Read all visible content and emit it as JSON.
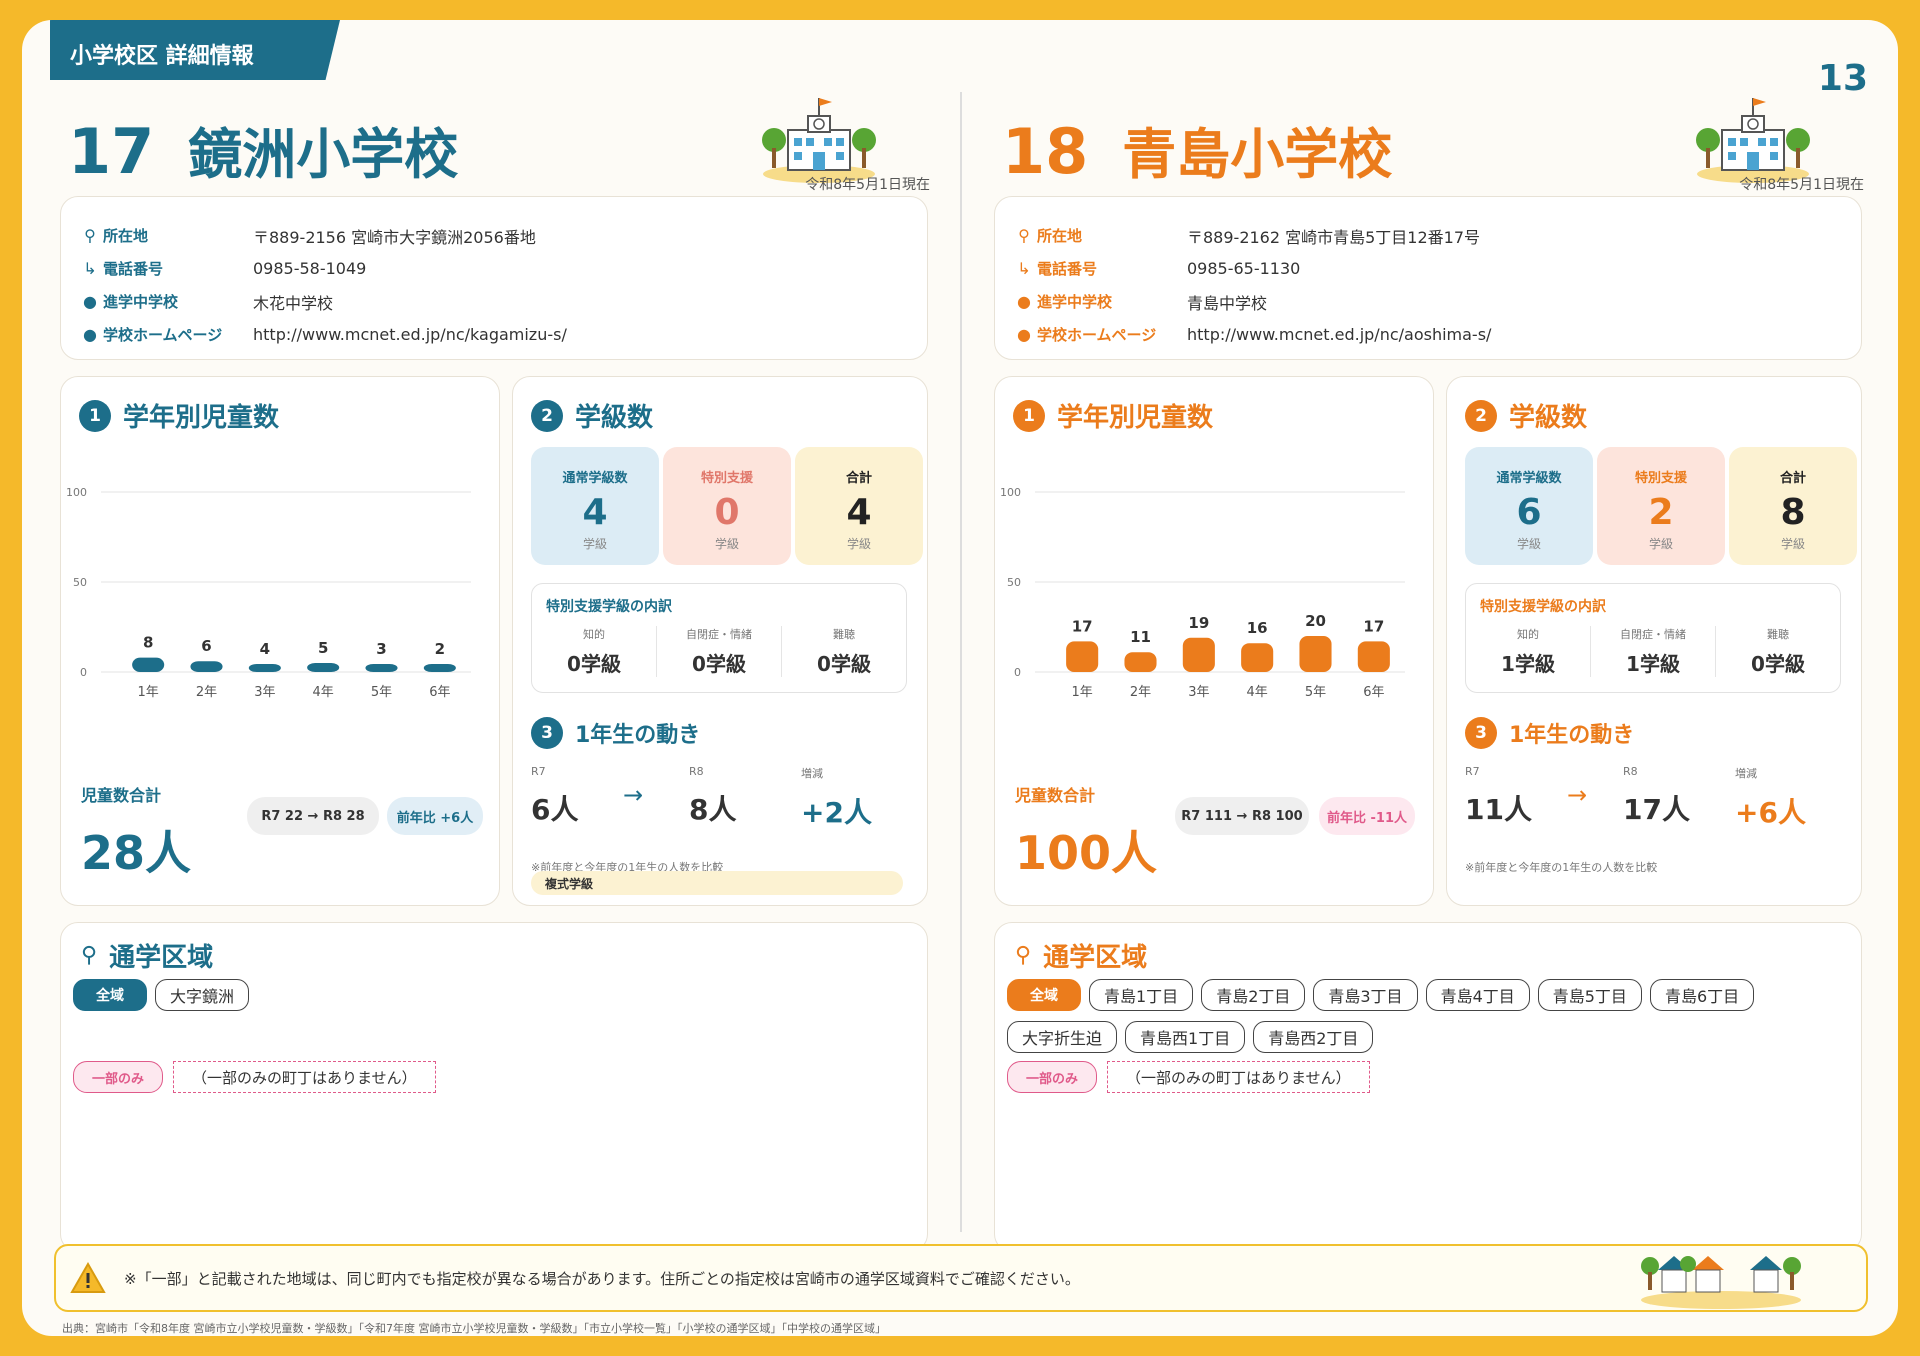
{
  "header": {
    "tab": "小学校区 詳細情報",
    "page_number": "13"
  },
  "schools": [
    {
      "number": "17",
      "name": "鏡洲小学校",
      "as_of": "令和8年5月1日現在",
      "info": [
        {
          "label": "所在地",
          "value": "〒889-2156 宮崎市大字鏡洲2056番地"
        },
        {
          "label": "電話番号",
          "value": "0985-58-1049"
        },
        {
          "label": "進学中学校",
          "value": "木花中学校"
        },
        {
          "label": "学校ホームページ",
          "value": "http://www.mcnet.ed.jp/nc/kagamizu-s/"
        }
      ],
      "grade_section": {
        "num": "1",
        "title": "学年別児童数",
        "chart_data": {
          "type": "bar",
          "categories": [
            "1年",
            "2年",
            "3年",
            "4年",
            "5年",
            "6年"
          ],
          "values": [
            8,
            6,
            4,
            5,
            3,
            2
          ],
          "ylim": [
            0,
            100
          ],
          "yticks": [
            "0",
            "50",
            "100"
          ],
          "grid": true
        },
        "total_label": "児童数合計",
        "total_value": "28人",
        "compare": "R7 22 → R8 28",
        "yoy": "前年比 +6人"
      },
      "class_section": {
        "num": "2",
        "title": "学級数",
        "boxes": [
          {
            "label": "通常学級数",
            "value": "4",
            "unit": "学級"
          },
          {
            "label": "特別支援",
            "value": "0",
            "unit": "学級"
          },
          {
            "label": "合計",
            "value": "4",
            "unit": "学級"
          }
        ],
        "breakdown_title": "特別支援学級の内訳",
        "breakdown": [
          {
            "label": "知的",
            "value": "0学級"
          },
          {
            "label": "自閉症・情緒",
            "value": "0学級"
          },
          {
            "label": "難聴",
            "value": "0学級"
          }
        ]
      },
      "move_section": {
        "num": "3",
        "title": "1年生の動き",
        "r7_label": "R7",
        "r7_value": "6人",
        "arrow": "→",
        "r8_label": "R8",
        "r8_value": "8人",
        "diff_label": "増減",
        "diff_value": "+2人",
        "note": "※前年度と今年度の1年生の人数を比較",
        "extra": "複式学級"
      },
      "area": {
        "title": "通学区域",
        "all_label": "全域",
        "all_items": [
          "大字鏡洲"
        ],
        "partial_label": "一部のみ",
        "partial_value": "（一部のみの町丁はありません）"
      }
    },
    {
      "number": "18",
      "name": "青島小学校",
      "as_of": "令和8年5月1日現在",
      "info": [
        {
          "label": "所在地",
          "value": "〒889-2162 宮崎市青島5丁目12番17号"
        },
        {
          "label": "電話番号",
          "value": "0985-65-1130"
        },
        {
          "label": "進学中学校",
          "value": "青島中学校"
        },
        {
          "label": "学校ホームページ",
          "value": "http://www.mcnet.ed.jp/nc/aoshima-s/"
        }
      ],
      "grade_section": {
        "num": "1",
        "title": "学年別児童数",
        "chart_data": {
          "type": "bar",
          "categories": [
            "1年",
            "2年",
            "3年",
            "4年",
            "5年",
            "6年"
          ],
          "values": [
            17,
            11,
            19,
            16,
            20,
            17
          ],
          "ylim": [
            0,
            100
          ],
          "yticks": [
            "0",
            "50",
            "100"
          ],
          "grid": true
        },
        "total_label": "児童数合計",
        "total_value": "100人",
        "compare": "R7 111 → R8 100",
        "yoy": "前年比 -11人"
      },
      "class_section": {
        "num": "2",
        "title": "学級数",
        "boxes": [
          {
            "label": "通常学級数",
            "value": "6",
            "unit": "学級"
          },
          {
            "label": "特別支援",
            "value": "2",
            "unit": "学級"
          },
          {
            "label": "合計",
            "value": "8",
            "unit": "学級"
          }
        ],
        "breakdown_title": "特別支援学級の内訳",
        "breakdown": [
          {
            "label": "知的",
            "value": "1学級"
          },
          {
            "label": "自閉症・情緒",
            "value": "1学級"
          },
          {
            "label": "難聴",
            "value": "0学級"
          }
        ]
      },
      "move_section": {
        "num": "3",
        "title": "1年生の動き",
        "r7_label": "R7",
        "r7_value": "11人",
        "arrow": "→",
        "r8_label": "R8",
        "r8_value": "17人",
        "diff_label": "増減",
        "diff_value": "+6人",
        "note": "※前年度と今年度の1年生の人数を比較",
        "extra": ""
      },
      "area": {
        "title": "通学区域",
        "all_label": "全域",
        "all_items": [
          "青島1丁目",
          "青島2丁目",
          "青島3丁目",
          "青島4丁目",
          "青島5丁目",
          "青島6丁目",
          "大字折生迫",
          "青島西1丁目",
          "青島西2丁目"
        ],
        "partial_label": "一部のみ",
        "partial_value": "（一部のみの町丁はありません）"
      }
    }
  ],
  "notice": "※「一部」と記載された地域は、同じ町内でも指定校が異なる場合があります。住所ごとの指定校は宮崎市の通学区域資料でご確認ください。",
  "source": "出典：宮崎市「令和8年度 宮崎市立小学校児童数・学級数」「令和7年度 宮崎市立小学校児童数・学級数」「市立小学校一覧」「小学校の通学区域」「中学校の通学区域」",
  "colors": {
    "teal": "#1d6e8a",
    "orange": "#eb7c1c",
    "pink": "#e05a8a",
    "background": "#f5b92a"
  },
  "icons": [
    "pin-icon",
    "phone-icon",
    "dot-icon",
    "school-building-icon",
    "warning-icon",
    "houses-icon"
  ]
}
